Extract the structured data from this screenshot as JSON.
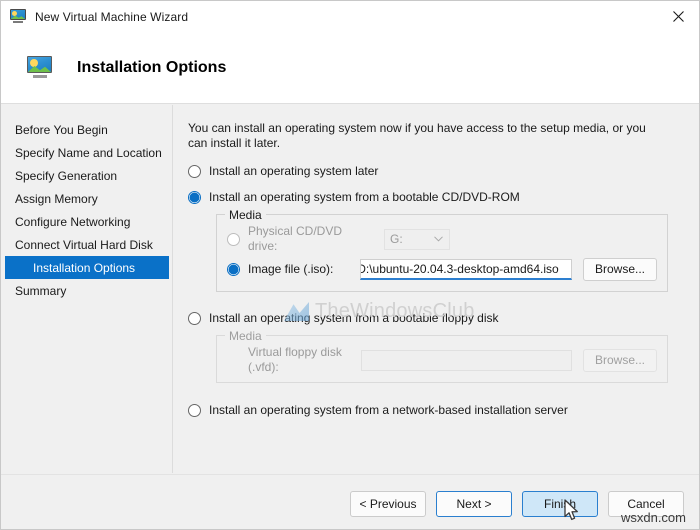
{
  "window": {
    "title": "New Virtual Machine Wizard",
    "icon": "virtual-machine-icon",
    "close_label": "✕"
  },
  "header": {
    "title": "Installation Options",
    "icon": "virtual-machine-icon"
  },
  "sidebar": {
    "items": [
      {
        "label": "Before You Begin",
        "selected": false
      },
      {
        "label": "Specify Name and Location",
        "selected": false
      },
      {
        "label": "Specify Generation",
        "selected": false
      },
      {
        "label": "Assign Memory",
        "selected": false
      },
      {
        "label": "Configure Networking",
        "selected": false
      },
      {
        "label": "Connect Virtual Hard Disk",
        "selected": false
      },
      {
        "label": "Installation Options",
        "selected": true
      },
      {
        "label": "Summary",
        "selected": false
      }
    ],
    "selected_bg": "#0a71c8"
  },
  "content": {
    "intro": "You can install an operating system now if you have access to the setup media, or you can install it later.",
    "options": [
      {
        "label": "Install an operating system later",
        "checked": false
      },
      {
        "label": "Install an operating system from a bootable CD/DVD-ROM",
        "checked": true
      },
      {
        "label": "Install an operating system from a bootable floppy disk",
        "checked": false
      },
      {
        "label": "Install an operating system from a network-based installation server",
        "checked": false
      }
    ],
    "cd_media": {
      "group_title": "Media",
      "physical": {
        "label": "Physical CD/DVD drive:",
        "checked": false,
        "drive_value": "G:",
        "chevron": "⌄"
      },
      "image": {
        "label": "Image file (.iso):",
        "checked": true,
        "path_value": "D:\\ubuntu-20.04.3-desktop-amd64.iso",
        "browse_label": "Browse..."
      }
    },
    "floppy_media": {
      "group_title": "Media",
      "label": "Virtual floppy disk (.vfd):",
      "path_value": "",
      "browse_label": "Browse..."
    }
  },
  "footer": {
    "buttons": [
      {
        "label": "< Previous",
        "state": "normal"
      },
      {
        "label": "Next >",
        "state": "default"
      },
      {
        "label": "Finish",
        "state": "hover"
      },
      {
        "label": "Cancel",
        "state": "normal"
      }
    ]
  },
  "watermarks": {
    "primary": "TheWindowsClub",
    "secondary": "wsxdn.com"
  }
}
